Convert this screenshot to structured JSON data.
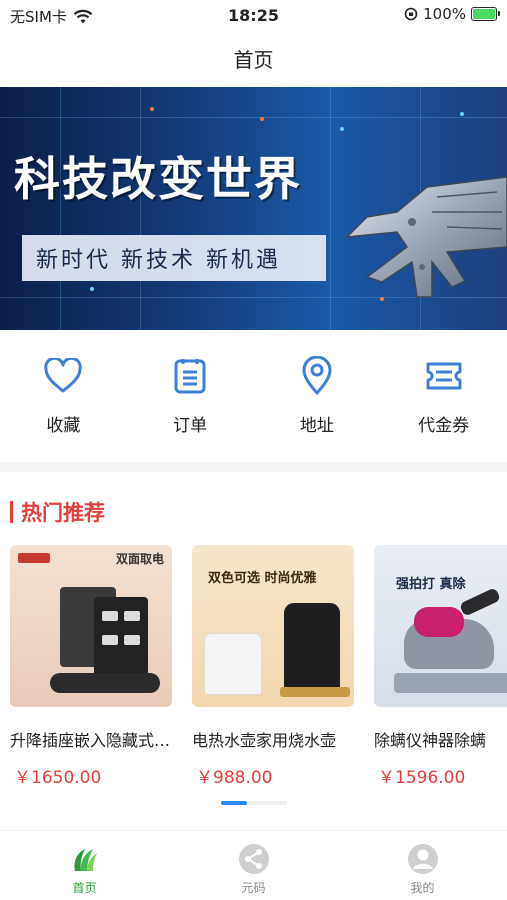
{
  "status_bar": {
    "carrier": "无SIM卡",
    "time": "18:25",
    "battery_percent": "100%"
  },
  "nav": {
    "title": "首页"
  },
  "banner": {
    "title": "科技改变世界",
    "subtitle": "新时代  新技术  新机遇"
  },
  "quick_menu": [
    {
      "label": "收藏",
      "icon": "heart-icon"
    },
    {
      "label": "订单",
      "icon": "order-list-icon"
    },
    {
      "label": "地址",
      "icon": "location-pin-icon"
    },
    {
      "label": "代金券",
      "icon": "coupon-ticket-icon"
    }
  ],
  "section": {
    "title": "热门推荐"
  },
  "products": [
    {
      "name": "升降插座嵌入隐藏式桌面插座",
      "price": "￥1650.00",
      "img_text": "双面取电"
    },
    {
      "name": "电热水壶家用烧水壶",
      "price": "￥988.00",
      "img_text": "双色可选 时尚优雅"
    },
    {
      "name": "除螨仪神器除螨",
      "price": "￥1596.00",
      "img_text": "强拍打 真除"
    }
  ],
  "tab_bar": [
    {
      "label": "首页",
      "icon": "leaf-logo-icon",
      "active": true
    },
    {
      "label": "元码",
      "icon": "share-icon",
      "active": false
    },
    {
      "label": "我的",
      "icon": "user-avatar-icon",
      "active": false
    }
  ],
  "colors": {
    "accent_red": "#e2403a",
    "icon_blue": "#3d7fd6",
    "active_green": "#2a9a3a",
    "indicator_blue": "#2f8af5"
  }
}
